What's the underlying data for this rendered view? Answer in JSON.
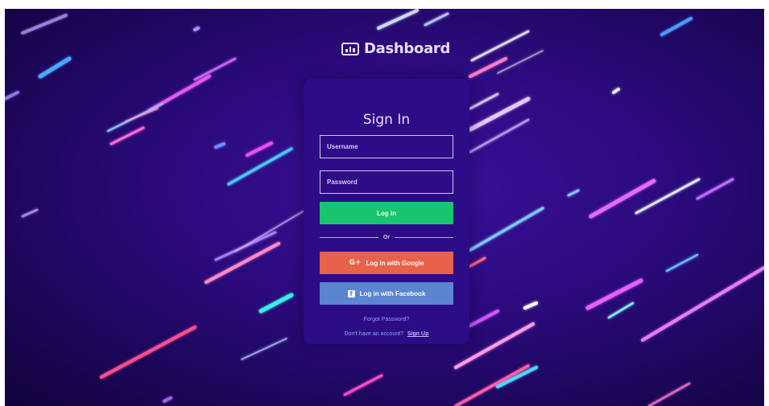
{
  "brand": {
    "title": "Dashboard",
    "icon": "chart-board-icon"
  },
  "signin": {
    "title": "Sign In",
    "username_placeholder": "Username",
    "password_placeholder": "Password",
    "login_label": "Log in",
    "divider_label": "Or",
    "google_label": "Log in with Google",
    "google_icon": "G+",
    "facebook_label": "Log in with Facebook",
    "facebook_icon": "f",
    "forgot_label": "Forgot Password?",
    "no_account_label": "Don't have an account?",
    "signup_label": "Sign Up"
  },
  "colors": {
    "background": "#2a0a7a",
    "card": "#2c0c86",
    "login_button": "#19c46f",
    "google_button": "#e8614b",
    "facebook_button": "#5b84d1",
    "link": "#8da2f2"
  }
}
